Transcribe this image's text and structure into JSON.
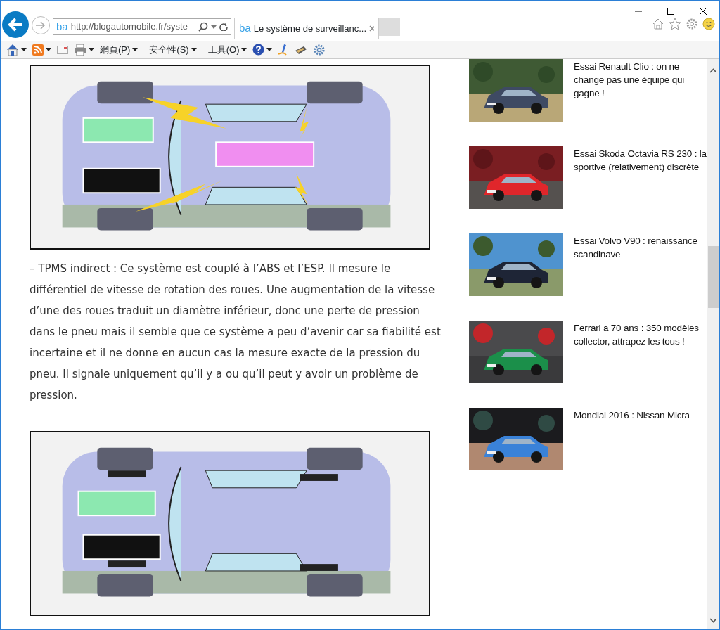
{
  "browser": {
    "site_icon": "ba",
    "tab_icon": "ba",
    "address": "http://blogautomobile.fr/syste",
    "tab_title": "Le système de surveillanc...",
    "commands": [
      "網頁(P)",
      "安全性(S)",
      "工具(O)"
    ]
  },
  "article": {
    "blocks": [
      {
        "kind": "picture"
      },
      {
        "kind": "paragraph",
        "text": "– TPMS indirect : Ce système est couplé à l’ABS et l’ESP. Il mesure le différentiel de vitesse de rotation des roues. Une augmentation de la vitesse d’une des roues traduit un diamètre inférieur, donc une perte de pression dans le pneu mais il semble que ce système a peu d’avenir car sa fiabilité est incertaine et il ne donne en aucun cas la mesure exacte de la pression du pneu. Il signale uniquement qu’il y a ou qu’il peut y avoir un problème de pression."
      },
      {
        "kind": "picture"
      }
    ]
  },
  "sidebar": {
    "posts": [
      {
        "title": "Essai Renault Clio : on ne change pas une équipe qui gagne !"
      },
      {
        "title": "Essai Skoda Octavia RS 230 : la sportive (relativement) discrète"
      },
      {
        "title": "Essai Volvo V90 : renaissance scandinave"
      },
      {
        "title": "Ferrari a 70 ans : 350 modèles collector, attrapez les tous !"
      },
      {
        "title": "Mondial 2016 : Nissan Micra"
      }
    ]
  }
}
